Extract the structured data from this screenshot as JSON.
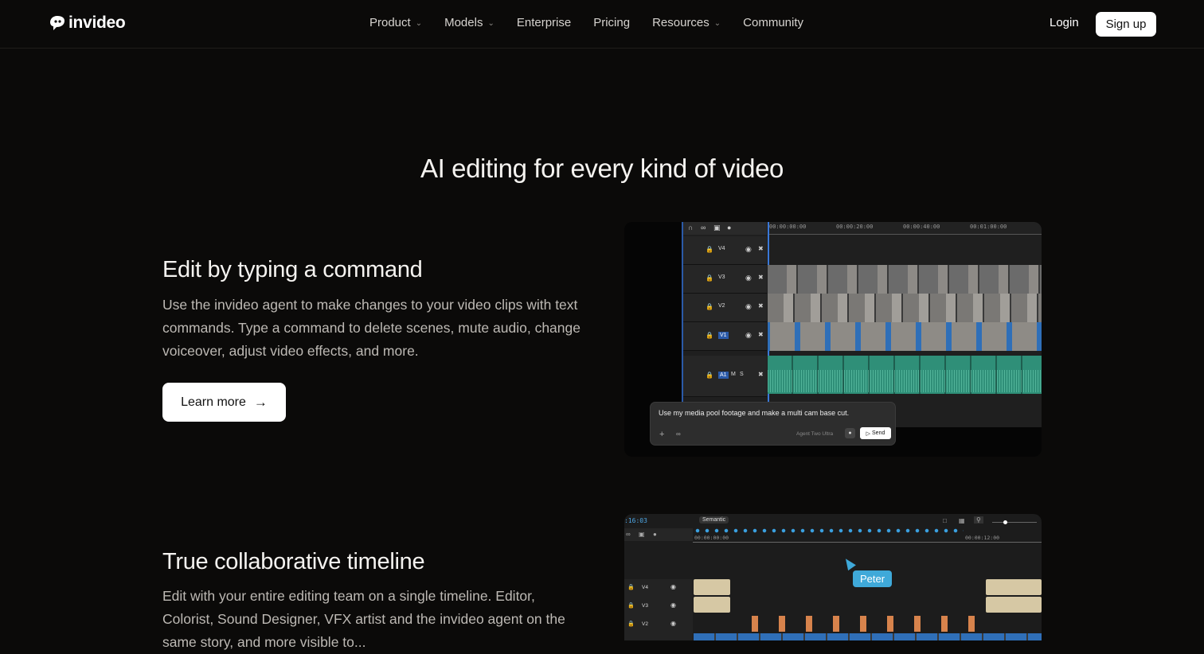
{
  "brand": {
    "name": "invideo"
  },
  "nav": {
    "items": [
      {
        "label": "Product",
        "has_dropdown": true
      },
      {
        "label": "Models",
        "has_dropdown": true
      },
      {
        "label": "Enterprise",
        "has_dropdown": false
      },
      {
        "label": "Pricing",
        "has_dropdown": false
      },
      {
        "label": "Resources",
        "has_dropdown": true
      },
      {
        "label": "Community",
        "has_dropdown": false
      }
    ],
    "login": "Login",
    "signup": "Sign up"
  },
  "hero": {
    "title": "AI editing for every kind of video"
  },
  "features": [
    {
      "title": "Edit by typing a command",
      "description": "Use the invideo agent to make changes to your video clips with text commands. Type a command to delete scenes, mute audio, change voiceover, adjust video effects, and more.",
      "cta": "Learn more",
      "preview": {
        "timecodes": [
          "00:00:00:00",
          "00:00:20:00",
          "00:00:40:00",
          "00:01:00:00"
        ],
        "tracks": [
          "V4",
          "V3",
          "V2",
          "V1",
          "A1"
        ],
        "command_text": "Use my media pool footage and make a multi cam base cut.",
        "agent_label": "Agent Two Ultra",
        "send_label": "Send"
      }
    },
    {
      "title": "True collaborative timeline",
      "description": "Edit with your entire editing team on a single timeline. Editor, Colorist, Sound Designer, VFX artist and the invideo agent on the same story, and more visible to...",
      "preview": {
        "timecode": ":16:03",
        "mode_label": "Semantic",
        "ruler": [
          "00:00:00:00",
          "00:00:12:00"
        ],
        "tracks": [
          "V4",
          "V3",
          "V2"
        ],
        "collaborator": "Peter"
      }
    }
  ],
  "colors": {
    "bg": "#0b0a09",
    "accent_blue": "#3fa9d9",
    "audio_green": "#2f8f78"
  }
}
